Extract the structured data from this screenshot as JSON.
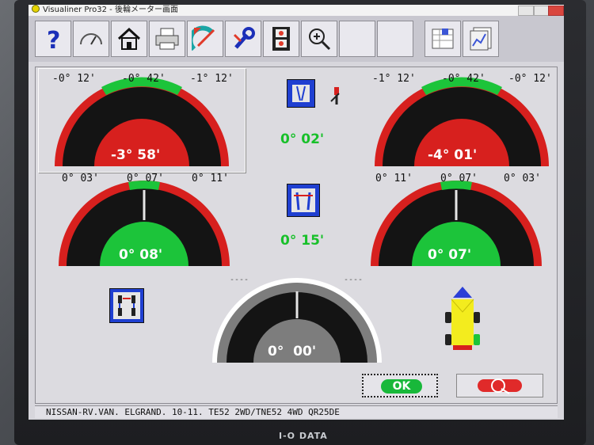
{
  "window": {
    "title": "Visualiner Pro32 - 後輪メーター画面"
  },
  "monitor": {
    "brand": "I-O DATA"
  },
  "toolbar": {
    "buttons": [
      {
        "name": "help-icon",
        "glyph": "?"
      },
      {
        "name": "speedometer-icon"
      },
      {
        "name": "home-icon"
      },
      {
        "name": "printer-icon"
      },
      {
        "name": "protractor-icon"
      },
      {
        "name": "wrench-icon"
      },
      {
        "name": "film-icon"
      },
      {
        "name": "zoom-icon"
      },
      {
        "name": "blank-1"
      },
      {
        "name": "blank-2"
      },
      {
        "name": "spreadsheet-icon"
      },
      {
        "name": "chart-icon"
      }
    ]
  },
  "camber_left": {
    "min": "-0° 12'",
    "center": "-0° 42'",
    "max": "-1° 12'",
    "value": "-3° 58'"
  },
  "camber_right": {
    "min": "-1° 12'",
    "center": "-0° 42'",
    "max": "-0° 12'",
    "value": "-4° 01'"
  },
  "camber_diff": {
    "value": "0° 02'"
  },
  "toe_left": {
    "min": "0° 03'",
    "center": "0° 07'",
    "max": "0° 11'",
    "value": "0° 08'"
  },
  "toe_right": {
    "min": "0° 11'",
    "center": "0° 07'",
    "max": "0° 03'",
    "value": "0° 07'"
  },
  "toe_total": {
    "value": "0° 15'"
  },
  "thrust": {
    "left_dash": "----",
    "right_dash": "----",
    "value": "0°  00'"
  },
  "buttons": {
    "ok_label": "OK"
  },
  "status": {
    "vehicle": "NISSAN-RV.VAN. ELGRAND. 10-11. TE52 2WD/TNE52 4WD QR25DE"
  },
  "colors": {
    "red": "#d7201e",
    "green": "#1cc43a",
    "black": "#141414",
    "gray": "#7d7d7d",
    "blue": "#1f3fd1"
  }
}
